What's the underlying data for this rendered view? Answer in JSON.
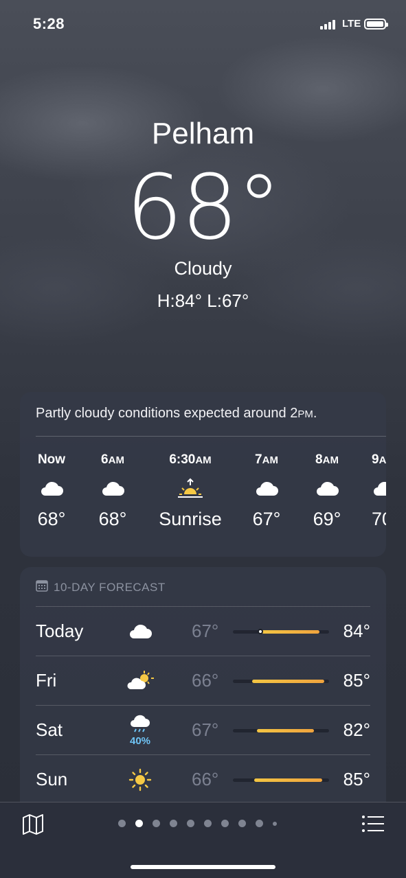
{
  "status": {
    "time": "5:28",
    "network": "LTE",
    "battery_level": 1.0,
    "signal_bars": 4
  },
  "location": {
    "city": "Pelham",
    "temperature": "68°",
    "condition": "Cloudy",
    "hi_lo": "H:84°  L:67°"
  },
  "hourly": {
    "summary_main": "Partly cloudy conditions expected around 2",
    "summary_suffix": "PM",
    "summary_end": ".",
    "hours": [
      {
        "label": "Now",
        "suffix": "",
        "icon": "cloud-icon",
        "value": "68°"
      },
      {
        "label": "6",
        "suffix": "AM",
        "icon": "cloud-icon",
        "value": "68°"
      },
      {
        "label": "6:30",
        "suffix": "AM",
        "icon": "sunrise-icon",
        "value": "Sunrise"
      },
      {
        "label": "7",
        "suffix": "AM",
        "icon": "cloud-icon",
        "value": "67°"
      },
      {
        "label": "8",
        "suffix": "AM",
        "icon": "cloud-icon",
        "value": "69°"
      },
      {
        "label": "9",
        "suffix": "A",
        "icon": "cloud-icon",
        "value": "70"
      }
    ]
  },
  "forecast": {
    "header": "10-DAY FORECAST",
    "header_icon": "calendar-icon",
    "days": [
      {
        "day": "Today",
        "icon": "cloud-icon",
        "precip": "",
        "low": "67°",
        "high": "84°",
        "range_start": 0.3,
        "range_end": 0.9,
        "current": 0.3
      },
      {
        "day": "Fri",
        "icon": "partly-sunny-icon",
        "precip": "",
        "low": "66°",
        "high": "85°",
        "range_start": 0.2,
        "range_end": 0.95
      },
      {
        "day": "Sat",
        "icon": "rain-cloud-icon",
        "precip": "40%",
        "low": "67°",
        "high": "82°",
        "range_start": 0.25,
        "range_end": 0.84
      },
      {
        "day": "Sun",
        "icon": "sun-icon",
        "precip": "",
        "low": "66°",
        "high": "85°",
        "range_start": 0.22,
        "range_end": 0.93
      }
    ]
  },
  "toolbar": {
    "map_icon": "map-icon",
    "list_icon": "list-icon",
    "page_count": 10,
    "active_page": 2
  },
  "colors": {
    "accent_bar_start": "#f3c543",
    "accent_bar_end": "#f0a33e",
    "precip": "#6fc4f5"
  }
}
